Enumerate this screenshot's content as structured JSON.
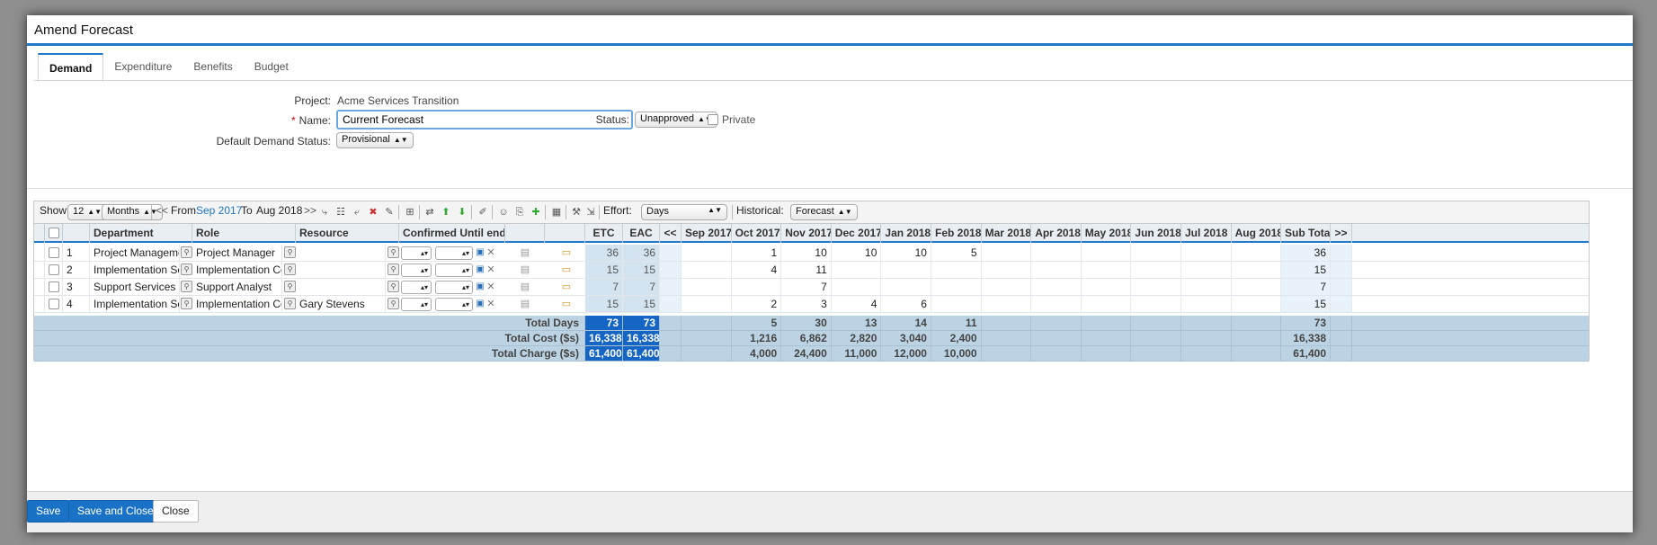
{
  "dialog": {
    "title": "Amend Forecast"
  },
  "tabs": [
    {
      "label": "Demand",
      "active": true
    },
    {
      "label": "Expenditure",
      "active": false
    },
    {
      "label": "Benefits",
      "active": false
    },
    {
      "label": "Budget",
      "active": false
    }
  ],
  "form": {
    "project_label": "Project:",
    "project_value": "Acme Services Transition",
    "name_label": "Name:",
    "name_required_mark": "*",
    "name_value": "Current Forecast",
    "status_label": "Status:",
    "status_value": "Unapproved",
    "private_label": "Private",
    "private_checked": false,
    "demand_status_label": "Default Demand Status:",
    "demand_status_value": "Provisional"
  },
  "toolbar": {
    "show_label": "Show:",
    "show_count": "12",
    "show_unit": "Months",
    "prev": "<<",
    "from_label": "From",
    "from_value": "Sep 2017",
    "to_label": "To",
    "to_value": "Aug 2018",
    "next": ">>",
    "effort_label": "Effort:",
    "effort_value": "Days",
    "historical_label": "Historical:",
    "historical_value": "Forecast"
  },
  "grid": {
    "headers": {
      "department": "Department",
      "role": "Role",
      "resource": "Resource",
      "confirmed": "Confirmed Until end of",
      "etc": "ETC",
      "eac": "EAC",
      "prev": "<<",
      "months": [
        "Sep 2017",
        "Oct 2017",
        "Nov 2017",
        "Dec 2017",
        "Jan 2018",
        "Feb 2018",
        "Mar 2018",
        "Apr 2018",
        "May 2018",
        "Jun 2018",
        "Jul 2018",
        "Aug 2018"
      ],
      "subtotal": "Sub Total",
      "next": ">>"
    },
    "rows": [
      {
        "num": "1",
        "department": "Project Management C",
        "role": "Project Manager",
        "resource": "",
        "etc": "36",
        "eac": "36",
        "months": [
          "",
          "1",
          "10",
          "10",
          "10",
          "5",
          "",
          "",
          "",
          "",
          "",
          ""
        ],
        "subtotal": "36"
      },
      {
        "num": "2",
        "department": "Implementation Servic",
        "role": "Implementation Consu",
        "resource": "",
        "etc": "15",
        "eac": "15",
        "months": [
          "",
          "4",
          "11",
          "",
          "",
          "",
          "",
          "",
          "",
          "",
          "",
          ""
        ],
        "subtotal": "15"
      },
      {
        "num": "3",
        "department": "Support Services",
        "role": "Support Analyst",
        "resource": "",
        "etc": "7",
        "eac": "7",
        "months": [
          "",
          "",
          "7",
          "",
          "",
          "",
          "",
          "",
          "",
          "",
          "",
          ""
        ],
        "subtotal": "7"
      },
      {
        "num": "4",
        "department": "Implementation Servic",
        "role": "Implementation Consu",
        "resource": "Gary Stevens",
        "etc": "15",
        "eac": "15",
        "months": [
          "",
          "2",
          "3",
          "4",
          "6",
          "",
          "",
          "",
          "",
          "",
          "",
          ""
        ],
        "subtotal": "15",
        "months_offset": 1
      }
    ],
    "totals": [
      {
        "label": "Total Days",
        "etc": "73",
        "eac": "73",
        "months": [
          "",
          "5",
          "30",
          "13",
          "14",
          "11",
          "",
          "",
          "",
          "",
          "",
          ""
        ],
        "subtotal": "73"
      },
      {
        "label": "Total Cost ($s)",
        "etc": "16,338",
        "eac": "16,338",
        "months": [
          "",
          "1,216",
          "6,862",
          "2,820",
          "3,040",
          "2,400",
          "",
          "",
          "",
          "",
          "",
          ""
        ],
        "subtotal": "16,338"
      },
      {
        "label": "Total Charge ($s)",
        "etc": "61,400",
        "eac": "61,400",
        "months": [
          "",
          "4,000",
          "24,400",
          "11,000",
          "12,000",
          "10,000",
          "",
          "",
          "",
          "",
          "",
          ""
        ],
        "subtotal": "61,400"
      }
    ]
  },
  "footer": {
    "save": "Save",
    "save_close": "Save and Close",
    "close": "Close"
  }
}
